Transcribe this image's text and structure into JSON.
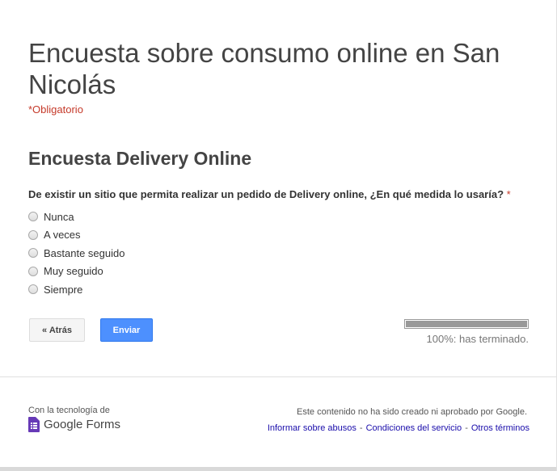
{
  "form": {
    "title": "Encuesta sobre consumo online en San Nicolás",
    "required_note": "*Obligatorio",
    "section_title": "Encuesta Delivery Online"
  },
  "question": {
    "text": "De existir un sitio que permita realizar un pedido de Delivery online, ¿En qué medida lo usaría?",
    "required_mark": "*",
    "options": [
      "Nunca",
      "A veces",
      "Bastante seguido",
      "Muy seguido",
      "Siempre"
    ],
    "selected": null
  },
  "buttons": {
    "back_label": "« Atrás",
    "submit_label": "Enviar"
  },
  "progress": {
    "percent": 100,
    "label": "100%: has terminado."
  },
  "footer": {
    "powered_by": "Con la tecnología de",
    "brand": "Google Forms",
    "disclaimer": "Este contenido no ha sido creado ni aprobado por Google.",
    "links": [
      "Informar sobre abusos",
      "Condiciones del servicio",
      "Otros términos"
    ],
    "separator": "-"
  },
  "colors": {
    "required": "#c53929",
    "submit_button": "#4d90fe",
    "progress_fill": "#999999",
    "link": "#1a0dab",
    "forms_icon": "#673ab7"
  },
  "icons": {
    "forms_logo": "google-forms-icon",
    "radio": "radio-button-unchecked"
  }
}
